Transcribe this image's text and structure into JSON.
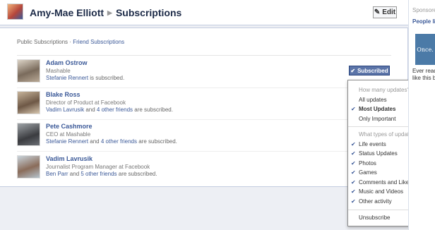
{
  "header": {
    "profile_name": "Amy-Mae Elliott",
    "section_title": "Subscriptions",
    "edit_label": "Edit"
  },
  "tabs": {
    "public": "Public Subscriptions",
    "separator": "·",
    "friend": "Friend Subscriptions"
  },
  "subscriptions": [
    {
      "name": "Adam Ostrow",
      "title": "Mashable",
      "friends_link": "Stefanie Rennert",
      "friends_text": " is subscribed.",
      "others_link": "",
      "others_tail": ""
    },
    {
      "name": "Blake Ross",
      "title": "Director of Product at Facebook",
      "friends_link": "Vadim Lavrusik",
      "friends_text": " and ",
      "others_link": "4 other friends",
      "others_tail": " are subscribed."
    },
    {
      "name": "Pete Cashmore",
      "title": "CEO at Mashable",
      "friends_link": "Stefanie Rennert",
      "friends_text": " and ",
      "others_link": "4 other friends",
      "others_tail": " are subscribed."
    },
    {
      "name": "Vadim Lavrusik",
      "title": "Journalist Program Manager at Facebook",
      "friends_link": "Ben Parr",
      "friends_text": " and ",
      "others_link": "5 other friends",
      "others_tail": " are subscribed."
    }
  ],
  "subscribed_button": "Subscribed",
  "menu": {
    "updates_heading": "How many updates?",
    "updates_options": [
      "All updates",
      "Most Updates",
      "Only Important"
    ],
    "types_heading": "What types of updates?",
    "types_options": [
      "Life events",
      "Status Updates",
      "Photos",
      "Games",
      "Comments and Likes",
      "Music and Videos",
      "Other activity"
    ],
    "unsubscribe": "Unsubscribe"
  },
  "sidebar": {
    "sponsored": "Sponsored",
    "people_like": "People li",
    "book_text": "Once.",
    "ever_read": "Ever read",
    "like_this": "like this be"
  },
  "colors": {
    "link": "#3b5998",
    "button": "#5b74a8",
    "header_text": "#1c2a47"
  }
}
